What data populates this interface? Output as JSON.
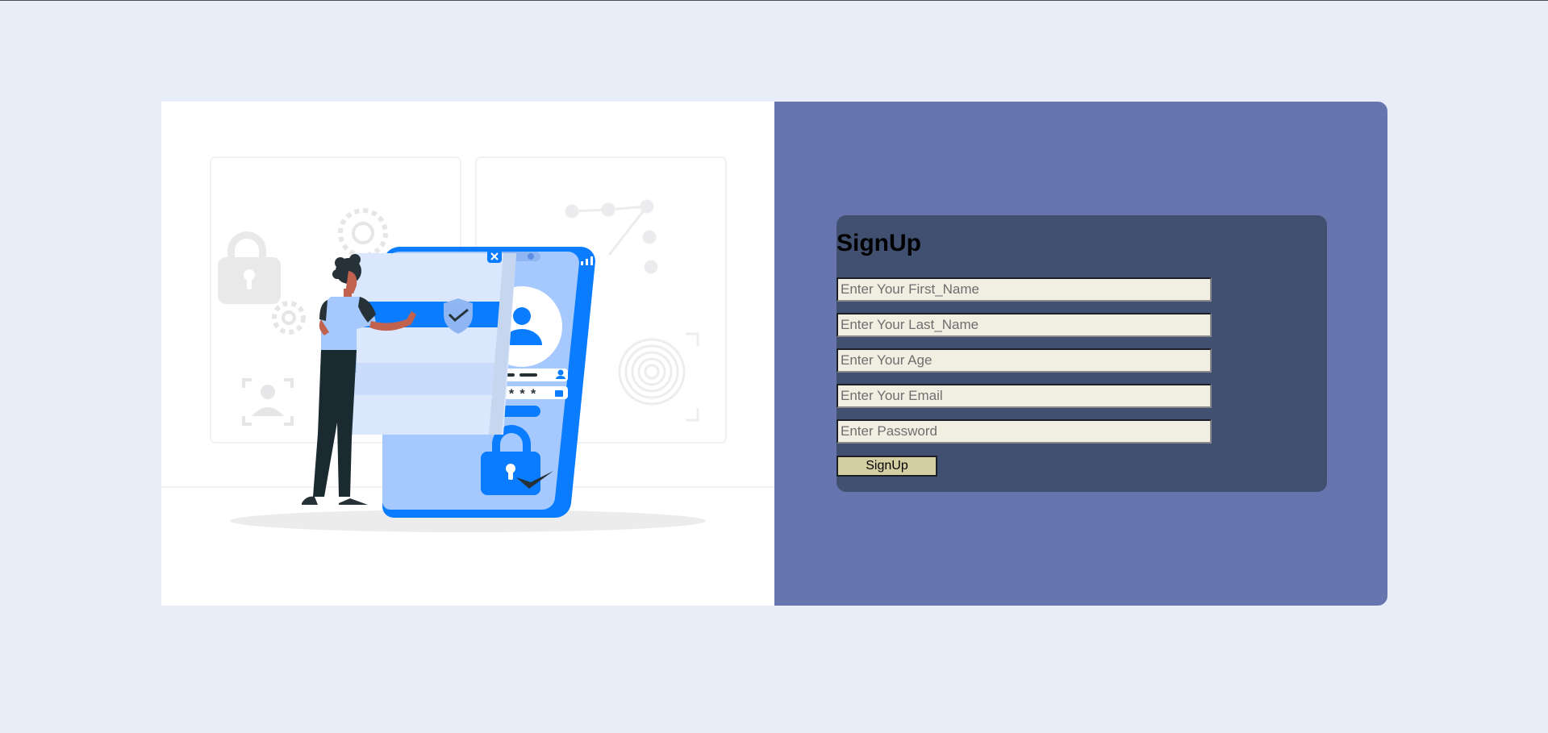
{
  "form": {
    "title": "SignUp",
    "fields": [
      {
        "name": "first-name-field",
        "placeholder": "Enter Your First_Name",
        "value": ""
      },
      {
        "name": "last-name-field",
        "placeholder": "Enter Your Last_Name",
        "value": ""
      },
      {
        "name": "age-field",
        "placeholder": "Enter Your Age",
        "value": ""
      },
      {
        "name": "email-field",
        "placeholder": "Enter Your Email",
        "value": ""
      },
      {
        "name": "password-field",
        "placeholder": "Enter Password",
        "value": ""
      }
    ],
    "submit_label": "SignUp"
  },
  "illustration": {
    "password_mask": "*****",
    "icons": [
      "lock-icon",
      "gear-icon",
      "user-icon",
      "fingerprint-icon",
      "shield-check-icon",
      "close-icon",
      "signal-icon"
    ]
  },
  "colors": {
    "page_bg": "#e7eef8",
    "right_panel": "#6675ae",
    "form_bg": "#415070",
    "input_bg": "#f1efe2",
    "button_bg": "#d3cfa3",
    "accent_blue": "#0a7cff",
    "light_blue": "#a5c8ff"
  }
}
